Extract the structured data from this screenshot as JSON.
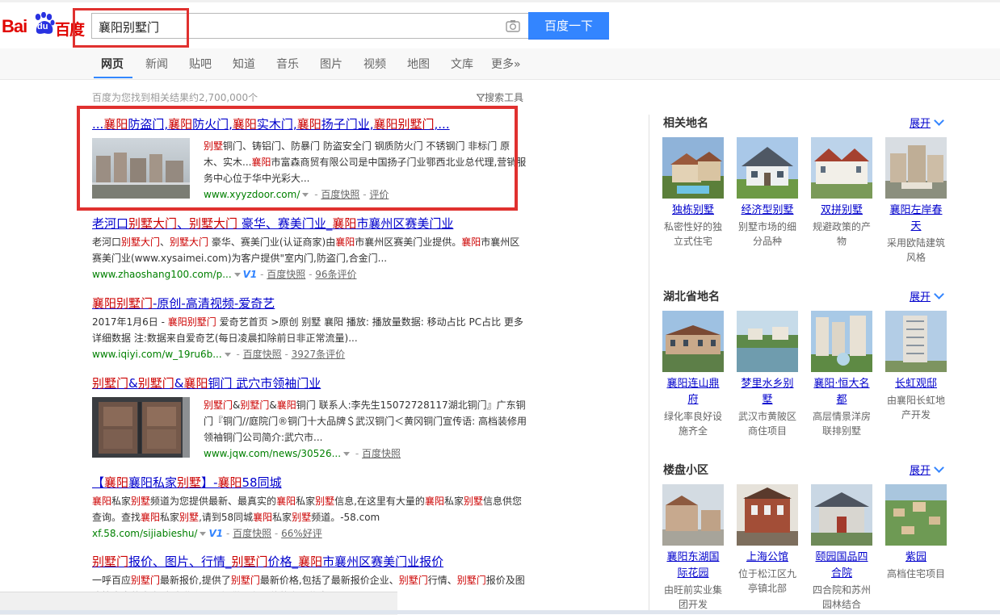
{
  "header": {
    "logo_text_left": "Bai",
    "logo_text_du": "du",
    "logo_text_right": "百度",
    "search_value": "襄阳别墅门",
    "search_button": "百度一下"
  },
  "nav": {
    "tabs": [
      "网页",
      "新闻",
      "贴吧",
      "知道",
      "音乐",
      "图片",
      "视频",
      "地图",
      "文库",
      "更多»"
    ]
  },
  "stats": "百度为您找到相关结果约2,700,000个",
  "tools": "搜索工具",
  "results": [
    {
      "title_html": "...<em>襄阳</em>防盗门,<em>襄阳</em>防火门,<em>襄阳</em>实木门,<em>襄阳</em>扬子门业,<em>襄阳别墅门</em>,...",
      "abs_html": "<em>别墅</em>铜门、铸铝门、防暴门 防盗安全门 钢质防火门 不锈钢门 非标门 原木、实木...<em>襄阳</em>市富森商贸有限公司是中国扬子门业鄂西北业总代理,营销服务中心位于华中光彩大...",
      "url": "www.xyyzdoor.com/",
      "snapshot": "百度快照",
      "extra": "评价"
    },
    {
      "title_html": "老河口<em>别墅大门</em>、<em>别墅大门</em> 豪华、赛美门业_<em>襄阳</em>市襄州区赛美门业",
      "abs_html": "老河口<em>别墅大门</em>、<em>别墅大门</em> 豪华、赛美门业(认证商家)由<em>襄阳</em>市襄州区赛美门业提供。<em>襄阳</em>市襄州区赛美门业(www.xysaimei.com)为客户提供\"室内门,防盗门,合金门...",
      "url": "www.zhaoshang100.com/p...",
      "badge": "V1",
      "snapshot": "百度快照",
      "extra": "96条评价"
    },
    {
      "title_html": "<em>襄阳别墅门</em>-原创-高清视频-爱奇艺",
      "abs_html": "2017年1月6日 - <em>襄阳别墅门</em> 爱奇艺首页 >原创 别墅 襄阳 播放: 播放量数据: 移动占比 PC占比 更多详细数据 注:数据来自爱奇艺(每日凌晨扣除前日非正常流量)...",
      "url": "www.iqiyi.com/w_19ru6b...",
      "snapshot": "百度快照",
      "extra": "3927条评价"
    },
    {
      "title_html": "<em>别墅门</em>&amp;<em>别墅门</em>&amp;<em>襄阳</em>铜门 武穴市领袖门业",
      "abs_html": "<em>别墅门</em>&amp;<em>别墅门</em>&amp;<em>襄阳</em>铜门 联系人:李先生15072728117湖北铜门』广东铜门『铜门//庭院门®铜门十大品牌＄武汉铜门＜黄冈铜门宣传语: 高档装修用领袖铜门公司简介:武穴市...",
      "url": "www.jqw.com/news/30526...",
      "snapshot": "百度快照"
    },
    {
      "title_html": "【<em>襄阳</em>襄阳私家<em>别墅</em>】-<em>襄阳</em>58同城",
      "abs_html": "<em>襄阳</em>私家<em>别墅</em>频道为您提供最新、最真实的<em>襄阳</em>私家<em>别墅</em>信息,在这里有大量的<em>襄阳</em>私家<em>别墅</em>信息供您查询。查找<em>襄阳</em>私家<em>别墅</em>,请到58同城<em>襄阳</em>私家<em>别墅</em>频道。-58.com",
      "url": "xf.58.com/sijiabieshu/",
      "badge": "V1",
      "snapshot": "百度快照",
      "extra": "66%好评"
    },
    {
      "title_html": "<em>别墅门</em>报价、图片、行情_<em>别墅门</em>价格_<em>襄阳</em>市襄州区赛美门业报价",
      "abs_html": "一呼百应<em>别墅门</em>最新报价,提供了<em>别墅门</em>最新价格,包括了最新报价企业、<em>别墅门</em>行情、<em>别墅门</em>报价及图片等丰富的内容,为企业和个人提供最有价值的产品信息..."
    }
  ],
  "right": {
    "expand": "展开",
    "sections": [
      {
        "title": "相关地名",
        "items": [
          {
            "name": "独栋别墅",
            "desc": "私密性好的独立式住宅"
          },
          {
            "name": "经济型别墅",
            "desc": "别墅市场的细分品种"
          },
          {
            "name": "双拼别墅",
            "desc": "规避政策的产物"
          },
          {
            "name": "襄阳左岸春天",
            "desc": "采用欧陆建筑风格"
          }
        ]
      },
      {
        "title": "湖北省地名",
        "items": [
          {
            "name": "襄阳连山鼎府",
            "desc": "绿化率良好设施齐全"
          },
          {
            "name": "梦里水乡别墅",
            "desc": "武汉市黄陂区商住项目"
          },
          {
            "name": "襄阳·恒大名都",
            "desc": "高层情景洋房联排别墅"
          },
          {
            "name": "长虹观邸",
            "desc": "由襄阳长虹地产开发"
          }
        ]
      },
      {
        "title": "楼盘小区",
        "items": [
          {
            "name": "襄阳东湖国际花园",
            "desc": "由旺前实业集团开发"
          },
          {
            "name": "上海公馆",
            "desc": "位于松江区九亭镇北部"
          },
          {
            "name": "颐园国品四合院",
            "desc": "四合院和苏州园林结合"
          },
          {
            "name": "紫园",
            "desc": "高档住宅项目"
          }
        ]
      }
    ]
  },
  "colors": {
    "brand_red": "#e10602",
    "brand_blue": "#3385ff",
    "link": "#0000cc",
    "highlight": "#cc0000",
    "url_green": "#008000",
    "annotation_red": "#e0312f"
  }
}
